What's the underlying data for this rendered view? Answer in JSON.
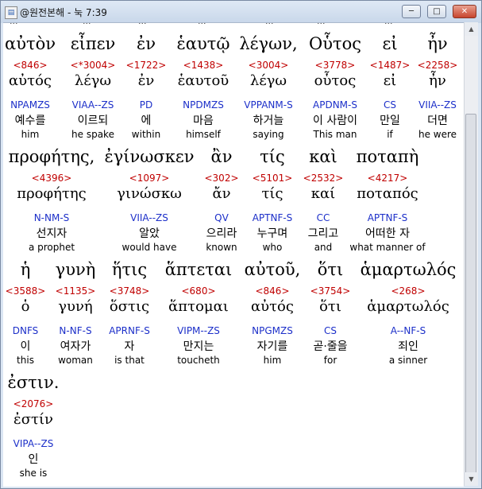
{
  "window": {
    "title": "@원전본해 - 눅 7:39",
    "app_icon": "app-book-icon",
    "min_label": "─",
    "max_label": "□",
    "close_label": "✕"
  },
  "cutoff_row": [
    "...",
    "...",
    "...",
    "...",
    "...",
    "...",
    "..."
  ],
  "verse_lines": [
    {
      "words": [
        {
          "greek": "αὐτὸν",
          "strong": "<846>",
          "lemma": "αὐτός",
          "parse": "NPAMZS",
          "korean": "예수를",
          "english": "him"
        },
        {
          "greek": "εἶπεν",
          "strong": "<*3004>",
          "lemma": "λέγω",
          "parse": "VIAA--ZS",
          "korean": "이르되",
          "english": "he spake"
        },
        {
          "greek": "ἐν",
          "strong": "<1722>",
          "lemma": "ἐν",
          "parse": "PD",
          "korean": "에",
          "english": "within"
        },
        {
          "greek": "ἑαυτῷ",
          "strong": "<1438>",
          "lemma": "ἑαυτοῦ",
          "parse": "NPDMZS",
          "korean": "마음",
          "english": "himself"
        },
        {
          "greek": "λέγων,",
          "strong": "<3004>",
          "lemma": "λέγω",
          "parse": "VPPANM-S",
          "korean": "하거늘",
          "english": "saying"
        },
        {
          "greek": "Οὗτος",
          "strong": "<3778>",
          "lemma": "οὗτος",
          "parse": "APDNM-S",
          "korean": "이 사람이",
          "english": "This man"
        },
        {
          "greek": "εἰ",
          "strong": "<1487>",
          "lemma": "εἰ",
          "parse": "CS",
          "korean": "만일",
          "english": "if"
        },
        {
          "greek": "ἦν",
          "strong": "<2258>",
          "lemma": "ἦν",
          "parse": "VIIA--ZS",
          "korean": "더면",
          "english": "he were"
        }
      ]
    },
    {
      "words": [
        {
          "greek": "προφήτης,",
          "strong": "<4396>",
          "lemma": "προφήτης",
          "parse": "N-NM-S",
          "korean": "선지자",
          "english": "a prophet"
        },
        {
          "greek": "ἐγίνωσκεν",
          "strong": "<1097>",
          "lemma": "γινώσκω",
          "parse": "VIIA--ZS",
          "korean": "알았",
          "english": "would have"
        },
        {
          "greek": "ἂν",
          "strong": "<302>",
          "lemma": "ἄν",
          "parse": "QV",
          "korean": "으리라",
          "english": "known"
        },
        {
          "greek": "τίς",
          "strong": "<5101>",
          "lemma": "τίς",
          "parse": "APTNF-S",
          "korean": "누구며",
          "english": "who"
        },
        {
          "greek": "καὶ",
          "strong": "<2532>",
          "lemma": "καί",
          "parse": "CC",
          "korean": "그리고",
          "english": "and"
        },
        {
          "greek": "ποταπὴ",
          "strong": "<4217>",
          "lemma": "ποταπός",
          "parse": "APTNF-S",
          "korean": "어떠한 자",
          "english": "what manner of"
        }
      ]
    },
    {
      "words": [
        {
          "greek": "ἡ",
          "strong": "<3588>",
          "lemma": "ὁ",
          "parse": "DNFS",
          "korean": "이",
          "english": "this"
        },
        {
          "greek": "γυνὴ",
          "strong": "<1135>",
          "lemma": "γυνή",
          "parse": "N-NF-S",
          "korean": "여자가",
          "english": "woman"
        },
        {
          "greek": "ἥτις",
          "strong": "<3748>",
          "lemma": "ὅστις",
          "parse": "APRNF-S",
          "korean": "자",
          "english": "is that"
        },
        {
          "greek": "ἅπτεται",
          "strong": "<680>",
          "lemma": "ἅπτομαι",
          "parse": "VIPM--ZS",
          "korean": "만지는",
          "english": "toucheth"
        },
        {
          "greek": "αὐτοῦ,",
          "strong": "<846>",
          "lemma": "αὐτός",
          "parse": "NPGMZS",
          "korean": "자기를",
          "english": "him"
        },
        {
          "greek": "ὅτι",
          "strong": "<3754>",
          "lemma": "ὅτι",
          "parse": "CS",
          "korean": "곧·줄을",
          "english": "for"
        },
        {
          "greek": "ἁμαρτωλός",
          "strong": "<268>",
          "lemma": "ἁμαρτωλός",
          "parse": "A--NF-S",
          "korean": "죄인",
          "english": "a sinner"
        }
      ]
    },
    {
      "words": [
        {
          "greek": "ἐστιν.",
          "strong": "<2076>",
          "lemma": "ἐστίν",
          "parse": "VIPA--ZS",
          "korean": "인",
          "english": "she is"
        }
      ]
    }
  ],
  "colors": {
    "strong": "#c00000",
    "parse": "#1c2fc9"
  }
}
